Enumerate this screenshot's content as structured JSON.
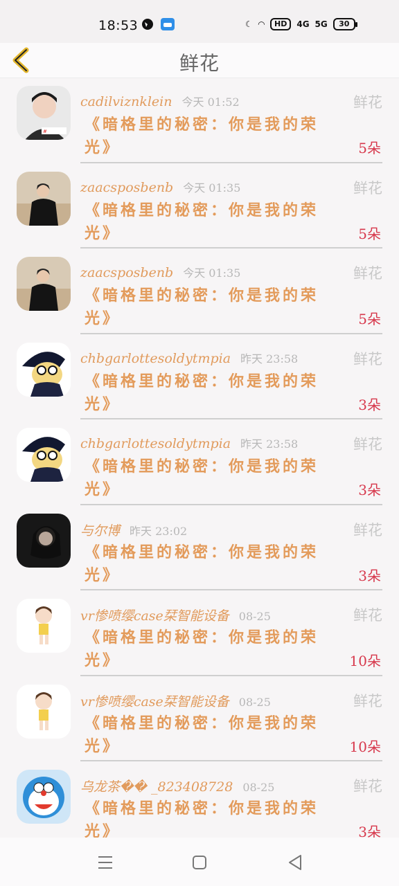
{
  "status": {
    "time": "18:53",
    "hd": "HD",
    "net1": "4G",
    "net2": "5G",
    "battery": "30"
  },
  "header": {
    "title": "鲜花"
  },
  "rows": [
    {
      "user": "cadilviznklein",
      "time": "今天 01:52",
      "tag": "鲜花",
      "book": "《暗格里的秘密：你是我的荣光》",
      "count": "5朵"
    },
    {
      "user": "zaacsposbenb",
      "time": "今天 01:35",
      "tag": "鲜花",
      "book": "《暗格里的秘密：你是我的荣光》",
      "count": "5朵"
    },
    {
      "user": "zaacsposbenb",
      "time": "今天 01:35",
      "tag": "鲜花",
      "book": "《暗格里的秘密：你是我的荣光》",
      "count": "5朵"
    },
    {
      "user": "chbgarlottesoldytmpia",
      "time": "昨天 23:58",
      "tag": "鲜花",
      "book": "《暗格里的秘密：你是我的荣光》",
      "count": "3朵"
    },
    {
      "user": "chbgarlottesoldytmpia",
      "time": "昨天 23:58",
      "tag": "鲜花",
      "book": "《暗格里的秘密：你是我的荣光》",
      "count": "3朵"
    },
    {
      "user": "与尔博",
      "time": "昨天 23:02",
      "tag": "鲜花",
      "book": "《暗格里的秘密：你是我的荣光》",
      "count": "3朵"
    },
    {
      "user": "vr惨喷缨case栞智能设备",
      "time": "08-25",
      "tag": "鲜花",
      "book": "《暗格里的秘密：你是我的荣光》",
      "count": "10朵"
    },
    {
      "user": "vr惨喷缨case栞智能设备",
      "time": "08-25",
      "tag": "鲜花",
      "book": "《暗格里的秘密：你是我的荣光》",
      "count": "10朵"
    },
    {
      "user": "乌龙茶�� _823408728",
      "time": "08-25",
      "tag": "鲜花",
      "book": "《暗格里的秘密：你是我的荣光》",
      "count": "3朵"
    }
  ],
  "colors": {
    "username": "#e19b5d",
    "book": "#e39b5b",
    "count": "#d7384c",
    "back_icon": "#e3b62c"
  }
}
